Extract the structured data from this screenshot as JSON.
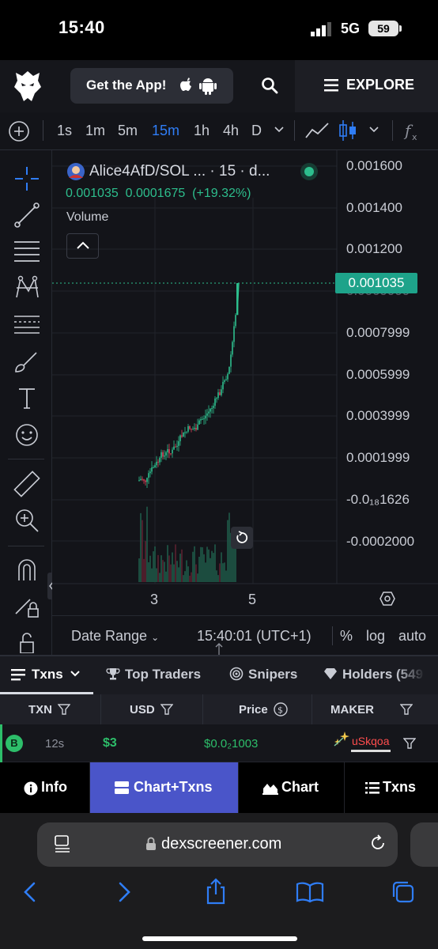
{
  "status_bar": {
    "time": "15:40",
    "network": "5G",
    "battery": "59"
  },
  "header": {
    "get_app_label": "Get the App!",
    "explore_label": "EXPLORE"
  },
  "toolbar": {
    "timeframes": [
      "1s",
      "1m",
      "5m",
      "15m",
      "1h",
      "4h",
      "D"
    ],
    "active_timeframe": "15m"
  },
  "chart": {
    "pair_title": "Alice4AfD/SOL ... · 15 · d...",
    "price": "0.001035",
    "change": "0.0001675",
    "change_pct": "(+19.32%)",
    "volume_label": "Volume",
    "current_price_tag": "0.001035",
    "y_labels": [
      "0.001600",
      "0.001400",
      "0.001200",
      "0.0007999",
      "0.0005999",
      "0.0003999",
      "0.0001999",
      "-0.0₁₈1626",
      "-0.0002000"
    ],
    "x_labels": [
      "3",
      "5"
    ],
    "accent_up": "#2dbe8d",
    "accent_down": "#e0405a"
  },
  "date_range": {
    "label": "Date Range",
    "time": "15:40:01 (UTC+1)",
    "pct": "%",
    "log": "log",
    "auto": "auto"
  },
  "tabs": {
    "txns": "Txns",
    "top_traders": "Top Traders",
    "snipers": "Snipers",
    "holders": "Holders (549"
  },
  "table": {
    "headers": {
      "txn": "TXN",
      "usd": "USD",
      "price": "Price",
      "maker": "MAKER"
    },
    "row": {
      "type": "B",
      "age": "12s",
      "usd": "$3",
      "price": "$0.0₂1003",
      "maker": "uSkqoa"
    }
  },
  "bottom_nav": {
    "info": "Info",
    "chart_txns": "Chart+Txns",
    "chart": "Chart",
    "txns": "Txns"
  },
  "safari": {
    "url": "dexscreener.com"
  }
}
